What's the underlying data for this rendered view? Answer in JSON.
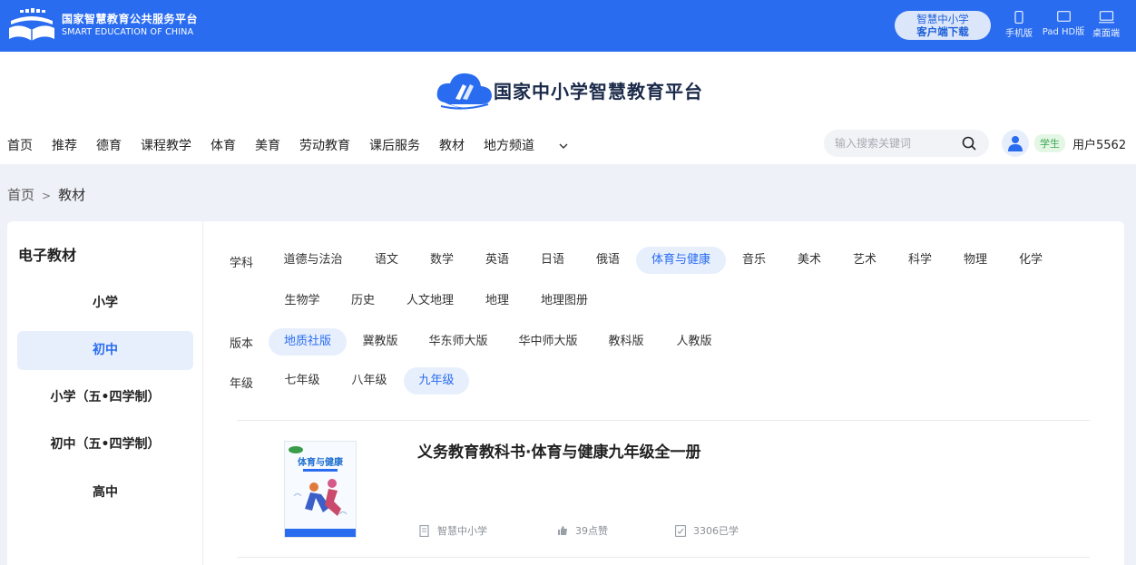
{
  "topbar": {
    "logo_cn": "国家智慧教育公共服务平台",
    "logo_en": "SMART EDUCATION OF CHINA",
    "download_line1": "智慧中小学",
    "download_line2": "客户端下载",
    "devices": [
      {
        "label": "手机版",
        "icon": "phone-icon"
      },
      {
        "label": "Pad HD版",
        "icon": "tablet-icon"
      },
      {
        "label": "桌面端",
        "icon": "desktop-icon"
      }
    ]
  },
  "header": {
    "title": "国家中小学智慧教育平台"
  },
  "nav": {
    "items": [
      "首页",
      "推荐",
      "德育",
      "课程教学",
      "体育",
      "美育",
      "劳动教育",
      "课后服务",
      "教材",
      "地方频道"
    ]
  },
  "search": {
    "placeholder": "输入搜索关键词"
  },
  "user": {
    "role": "学生",
    "name": "用户5562"
  },
  "breadcrumb": {
    "home": "首页",
    "separator": ">",
    "current": "教材"
  },
  "sidebar": {
    "title": "电子教材",
    "items": [
      "小学",
      "初中",
      "小学（五•四学制）",
      "初中（五•四学制）",
      "高中"
    ],
    "active_index": 1
  },
  "filters": {
    "subject_label": "学科",
    "subjects_row1": [
      "道德与法治",
      "语文",
      "数学",
      "英语",
      "日语",
      "俄语",
      "体育与健康",
      "音乐",
      "美术",
      "艺术",
      "科学",
      "物理",
      "化学"
    ],
    "subjects_row2": [
      "生物学",
      "历史",
      "人文地理",
      "地理",
      "地理图册"
    ],
    "active_subject": "体育与健康",
    "edition_label": "版本",
    "editions": [
      "地质社版",
      "冀教版",
      "华东师大版",
      "华中师大版",
      "教科版",
      "人教版"
    ],
    "active_edition": "地质社版",
    "grade_label": "年级",
    "grades": [
      "七年级",
      "八年级",
      "九年级"
    ],
    "active_grade": "九年级"
  },
  "book": {
    "title": "义务教育教科书·体育与健康九年级全一册",
    "cover_text": "体育与健康",
    "source": "智慧中小学",
    "likes": "39点赞",
    "learners": "3306已学"
  },
  "colors": {
    "brand_blue": "#2a6cf0",
    "active_bg": "#e7effd",
    "page_bg": "#eef1f7"
  }
}
